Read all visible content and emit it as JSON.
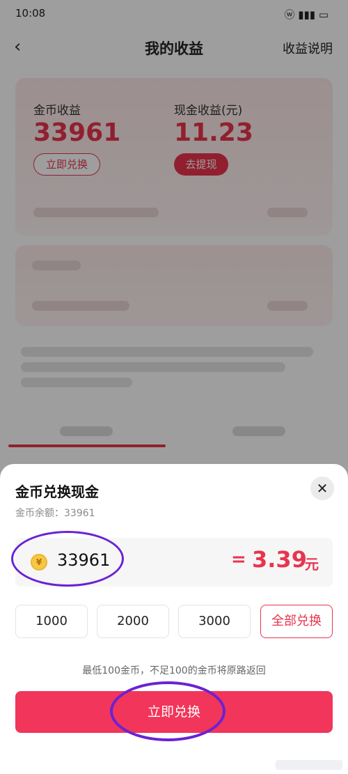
{
  "status_bar": {
    "time": "10:08",
    "icons": "ⓦ ▮▮▮ ▭"
  },
  "header": {
    "title": "我的收益",
    "right_link": "收益说明"
  },
  "earnings": {
    "coin_label": "金币收益",
    "coin_value": "33961",
    "coin_button": "立即兑换",
    "cash_label": "现金收益(元)",
    "cash_value": "11.23",
    "cash_button": "去提现"
  },
  "exchange_sheet": {
    "title": "金币兑换现金",
    "balance_label": "金币余额：33961",
    "coin_symbol": "¥",
    "input_value": "33961",
    "equals": "=",
    "result_amount": "3.39",
    "result_unit": "元",
    "quick_options": [
      "1000",
      "2000",
      "3000",
      "全部兑换"
    ],
    "hint": "最低100金币，不足100的金币将原路返回",
    "submit_label": "立即兑换"
  },
  "colors": {
    "accent": "#e8344e",
    "submit": "#f2355a",
    "annotation": "#6a22d4"
  }
}
